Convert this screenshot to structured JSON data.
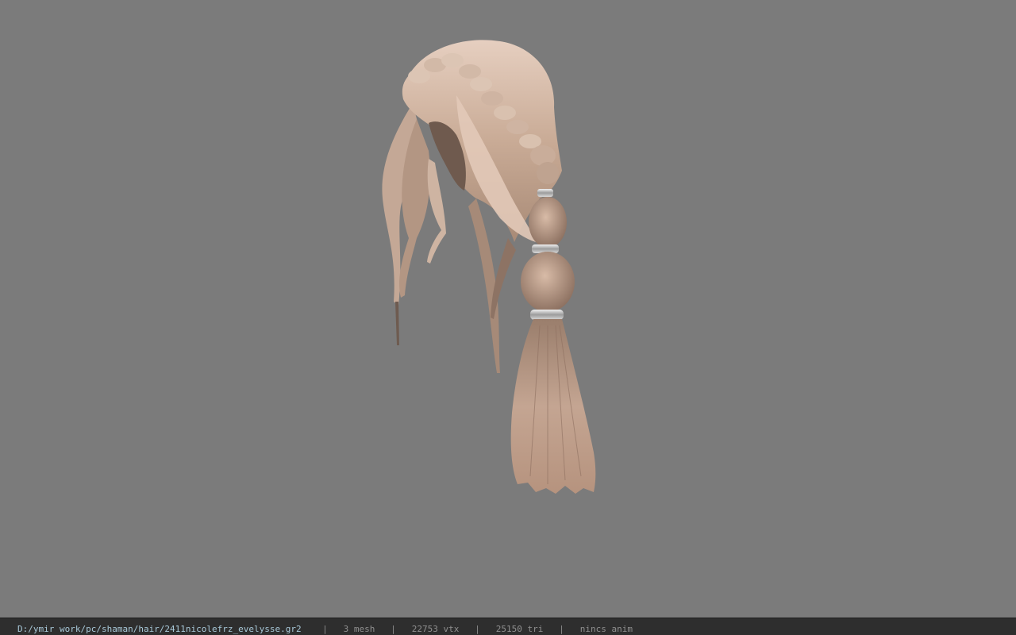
{
  "viewer": {
    "background_color": "#7b7b7b",
    "model_icon": "hair-mesh-icon"
  },
  "status_bar": {
    "file_path": "D:/ymir work/pc/shaman/hair/2411nicolefrz_evelysse.gr2",
    "separator": "|",
    "mesh_count": "3 mesh",
    "vertex_count": "22753 vtx",
    "triangle_count": "25150 tri",
    "anim_status": "nincs anim",
    "bar_color": "#2e2e2e",
    "path_color": "#a8c8d8"
  }
}
